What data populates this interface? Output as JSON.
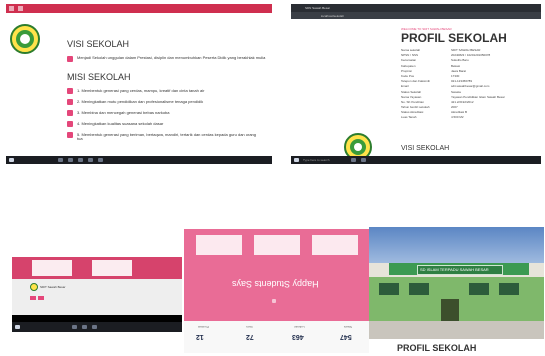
{
  "shot1": {
    "visi_heading": "VISI SEKOLAH",
    "visi_text": "Menjadi Sekolah unggulan dalam Prestasi, disiplin dan menumbuhkan Peserta Didik yang berakhlak mulia",
    "misi_heading": "MISI SEKOLAH",
    "misi_items": [
      "1. Membentuk generasi yang cerdas, mampu, kreatif dan cinta tanah air",
      "2. Meningkatkan mutu pendidikan dan profesionalisme tenaga pendidik",
      "3. Membina dan mencegah generasi bebas narkoba",
      "4. Meningkatkan kualitas suasana sekolah dasar",
      "5. Membentuk generasi yang beriman, bertaqwa, mandiri, tertarik dan cerdas kepada guru dan orang tua"
    ]
  },
  "shot2": {
    "tab_label": "SDN Sawah Besar",
    "url": "localhost/sekolah",
    "breadcrumb": "WELCOME TO SDIT SAWAH BESAR",
    "title": "PROFIL SEKOLAH",
    "profile_rows": [
      [
        "Nama sekolah",
        "SDIT SAWAH BESAR"
      ],
      [
        "NPSN / NSS",
        "20240823 / 10201201050078"
      ],
      [
        "Kecamatan",
        "Sukolilo Baru"
      ],
      [
        "Kabupaten",
        "Bekasi"
      ],
      [
        "Propinsi",
        "Jawa Barat"
      ],
      [
        "Kode Pos",
        "17330"
      ],
      [
        "Telepon dan Faksimili",
        "021-123456789"
      ],
      [
        "Email",
        "sdit.sawahbesar@gmail.com"
      ],
      [
        "Status Sekolah",
        "Swasta"
      ],
      [
        "Nama Yayasan",
        "Yayasan Pendidikan Islam Sawah Besar"
      ],
      [
        "No. SK Pendirian",
        "421.2/2192/2012"
      ],
      [
        "Tahun berdiri sekolah",
        "2007"
      ],
      [
        "Status Akreditasi",
        "Akreditasi B"
      ],
      [
        "Luas Tanah",
        "4.500 M2"
      ]
    ],
    "visi_heading": "VISI SEKOLAH",
    "search_placeholder": "Type here to search"
  },
  "shot3": {
    "tab_label": "SDN Sawah Besar",
    "notice": "SDIT Sawah Besar"
  },
  "shot4": {
    "banner_text": "Happy Students Says",
    "stats": [
      {
        "value": "547",
        "label": "Siswa"
      },
      {
        "value": "463",
        "label": "Lulusan"
      },
      {
        "value": "72",
        "label": "Guru"
      },
      {
        "value": "12",
        "label": "Prestasi"
      }
    ]
  },
  "shot5": {
    "sign_text": "SD ISLAM TERPADU SAWAH BESAR",
    "title": "PROFIL SEKOLAH"
  },
  "colors": {
    "accent_pink": "#e4477a",
    "accent_red": "#cf2f4f",
    "dark": "#1b1d22"
  }
}
